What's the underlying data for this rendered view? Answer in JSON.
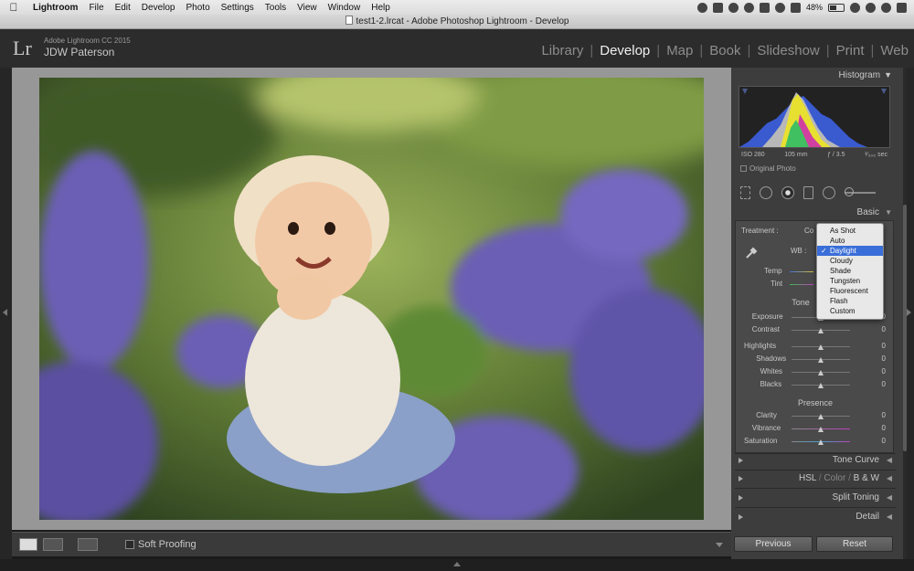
{
  "menubar": {
    "apple": "",
    "items": [
      "Lightroom",
      "File",
      "Edit",
      "Develop",
      "Photo",
      "Settings",
      "Tools",
      "View",
      "Window",
      "Help"
    ],
    "battery": "48%"
  },
  "window": {
    "title": "test1-2.lrcat - Adobe Photoshop Lightroom - Develop"
  },
  "identity": {
    "logo": "Lr",
    "version": "Adobe Lightroom CC 2015",
    "user": "JDW Paterson"
  },
  "modules": [
    "Library",
    "Develop",
    "Map",
    "Book",
    "Slideshow",
    "Print",
    "Web"
  ],
  "active_module": "Develop",
  "toolbar": {
    "soft_proofing": "Soft Proofing"
  },
  "histogram": {
    "header": "Histogram",
    "iso": "ISO 280",
    "focal": "105 mm",
    "aperture": "ƒ / 3.5",
    "shutter": "¹⁄₂₀₀ sec",
    "original_photo": "Original Photo"
  },
  "basic": {
    "header": "Basic",
    "treatment_label": "Treatment :",
    "treatment_value": "Co",
    "wb_label": "WB :",
    "temp_label": "Temp",
    "tint_label": "Tint",
    "tone_label": "Tone",
    "presence_label": "Presence",
    "sliders": [
      {
        "label": "Exposure",
        "value": "0"
      },
      {
        "label": "Contrast",
        "value": "0"
      },
      {
        "label": "Highlights",
        "value": "0"
      },
      {
        "label": "Shadows",
        "value": "0"
      },
      {
        "label": "Whites",
        "value": "0"
      },
      {
        "label": "Blacks",
        "value": "0"
      },
      {
        "label": "Clarity",
        "value": "0"
      },
      {
        "label": "Vibrance",
        "value": "0"
      },
      {
        "label": "Saturation",
        "value": "0"
      }
    ]
  },
  "wb_dropdown": {
    "options": [
      "As Shot",
      "Auto",
      "Daylight",
      "Cloudy",
      "Shade",
      "Tungsten",
      "Fluorescent",
      "Flash",
      "Custom"
    ],
    "selected": "Daylight"
  },
  "panels": {
    "tone_curve": "Tone Curve",
    "hsl": "HSL",
    "color": "Color",
    "bw": "B & W",
    "hsl_sep": "/",
    "split_toning": "Split Toning",
    "detail": "Detail"
  },
  "buttons": {
    "previous": "Previous",
    "reset": "Reset"
  },
  "colors": {
    "panel_bg": "#3d3d3d",
    "highlight": "#3a6ed8",
    "photo_green": "#6f8a3a",
    "photo_purple": "#6b5fb5"
  }
}
